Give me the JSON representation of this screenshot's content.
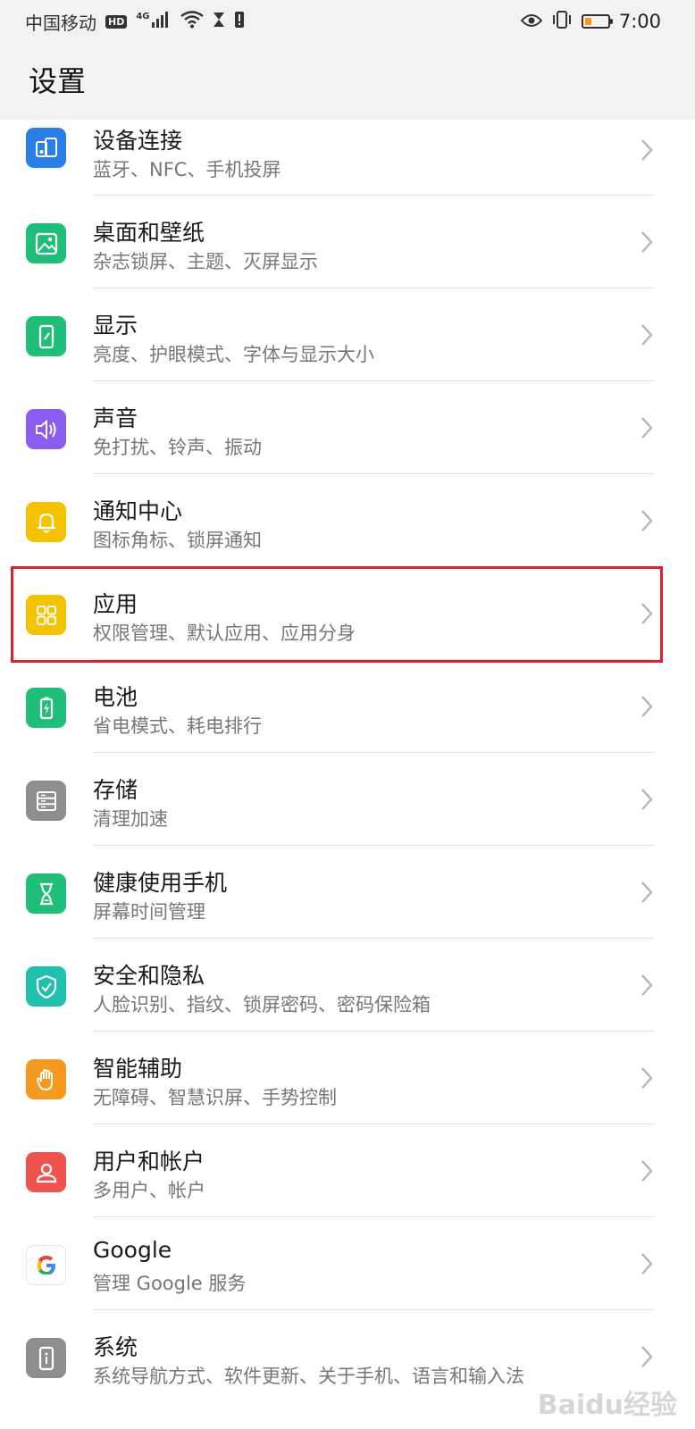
{
  "status_bar": {
    "carrier": "中国移动",
    "hd": "HD",
    "network": "4G",
    "time": "7:00"
  },
  "header": {
    "title": "设置"
  },
  "items": [
    {
      "title": "设备连接",
      "subtitle": "蓝牙、NFC、手机投屏",
      "icon": "device-connection-icon",
      "color": "#2a7fe6"
    },
    {
      "title": "桌面和壁纸",
      "subtitle": "杂志锁屏、主题、灭屏显示",
      "icon": "wallpaper-icon",
      "color": "#1fbf7a"
    },
    {
      "title": "显示",
      "subtitle": "亮度、护眼模式、字体与显示大小",
      "icon": "display-icon",
      "color": "#1fbf7a"
    },
    {
      "title": "声音",
      "subtitle": "免打扰、铃声、振动",
      "icon": "sound-icon",
      "color": "#8a5cf0"
    },
    {
      "title": "通知中心",
      "subtitle": "图标角标、锁屏通知",
      "icon": "bell-icon",
      "color": "#f5c200"
    },
    {
      "title": "应用",
      "subtitle": "权限管理、默认应用、应用分身",
      "icon": "apps-grid-icon",
      "color": "#f5c200"
    },
    {
      "title": "电池",
      "subtitle": "省电模式、耗电排行",
      "icon": "battery-icon",
      "color": "#1fbf7a"
    },
    {
      "title": "存储",
      "subtitle": "清理加速",
      "icon": "storage-icon",
      "color": "#8e8e8e"
    },
    {
      "title": "健康使用手机",
      "subtitle": "屏幕时间管理",
      "icon": "hourglass-icon",
      "color": "#1fbf7a"
    },
    {
      "title": "安全和隐私",
      "subtitle": "人脸识别、指纹、锁屏密码、密码保险箱",
      "icon": "shield-icon",
      "color": "#1fc0b0"
    },
    {
      "title": "智能辅助",
      "subtitle": "无障碍、智慧识屏、手势控制",
      "icon": "hand-icon",
      "color": "#f59a1f"
    },
    {
      "title": "用户和帐户",
      "subtitle": "多用户、帐户",
      "icon": "user-icon",
      "color": "#ef5350"
    },
    {
      "title": "Google",
      "subtitle": "管理 Google 服务",
      "icon": "google-icon",
      "color": "#ffffff"
    },
    {
      "title": "系统",
      "subtitle": "系统导航方式、软件更新、关于手机、语言和输入法",
      "icon": "system-icon",
      "color": "#8e8e8e"
    }
  ],
  "watermark": "Baidu经验"
}
